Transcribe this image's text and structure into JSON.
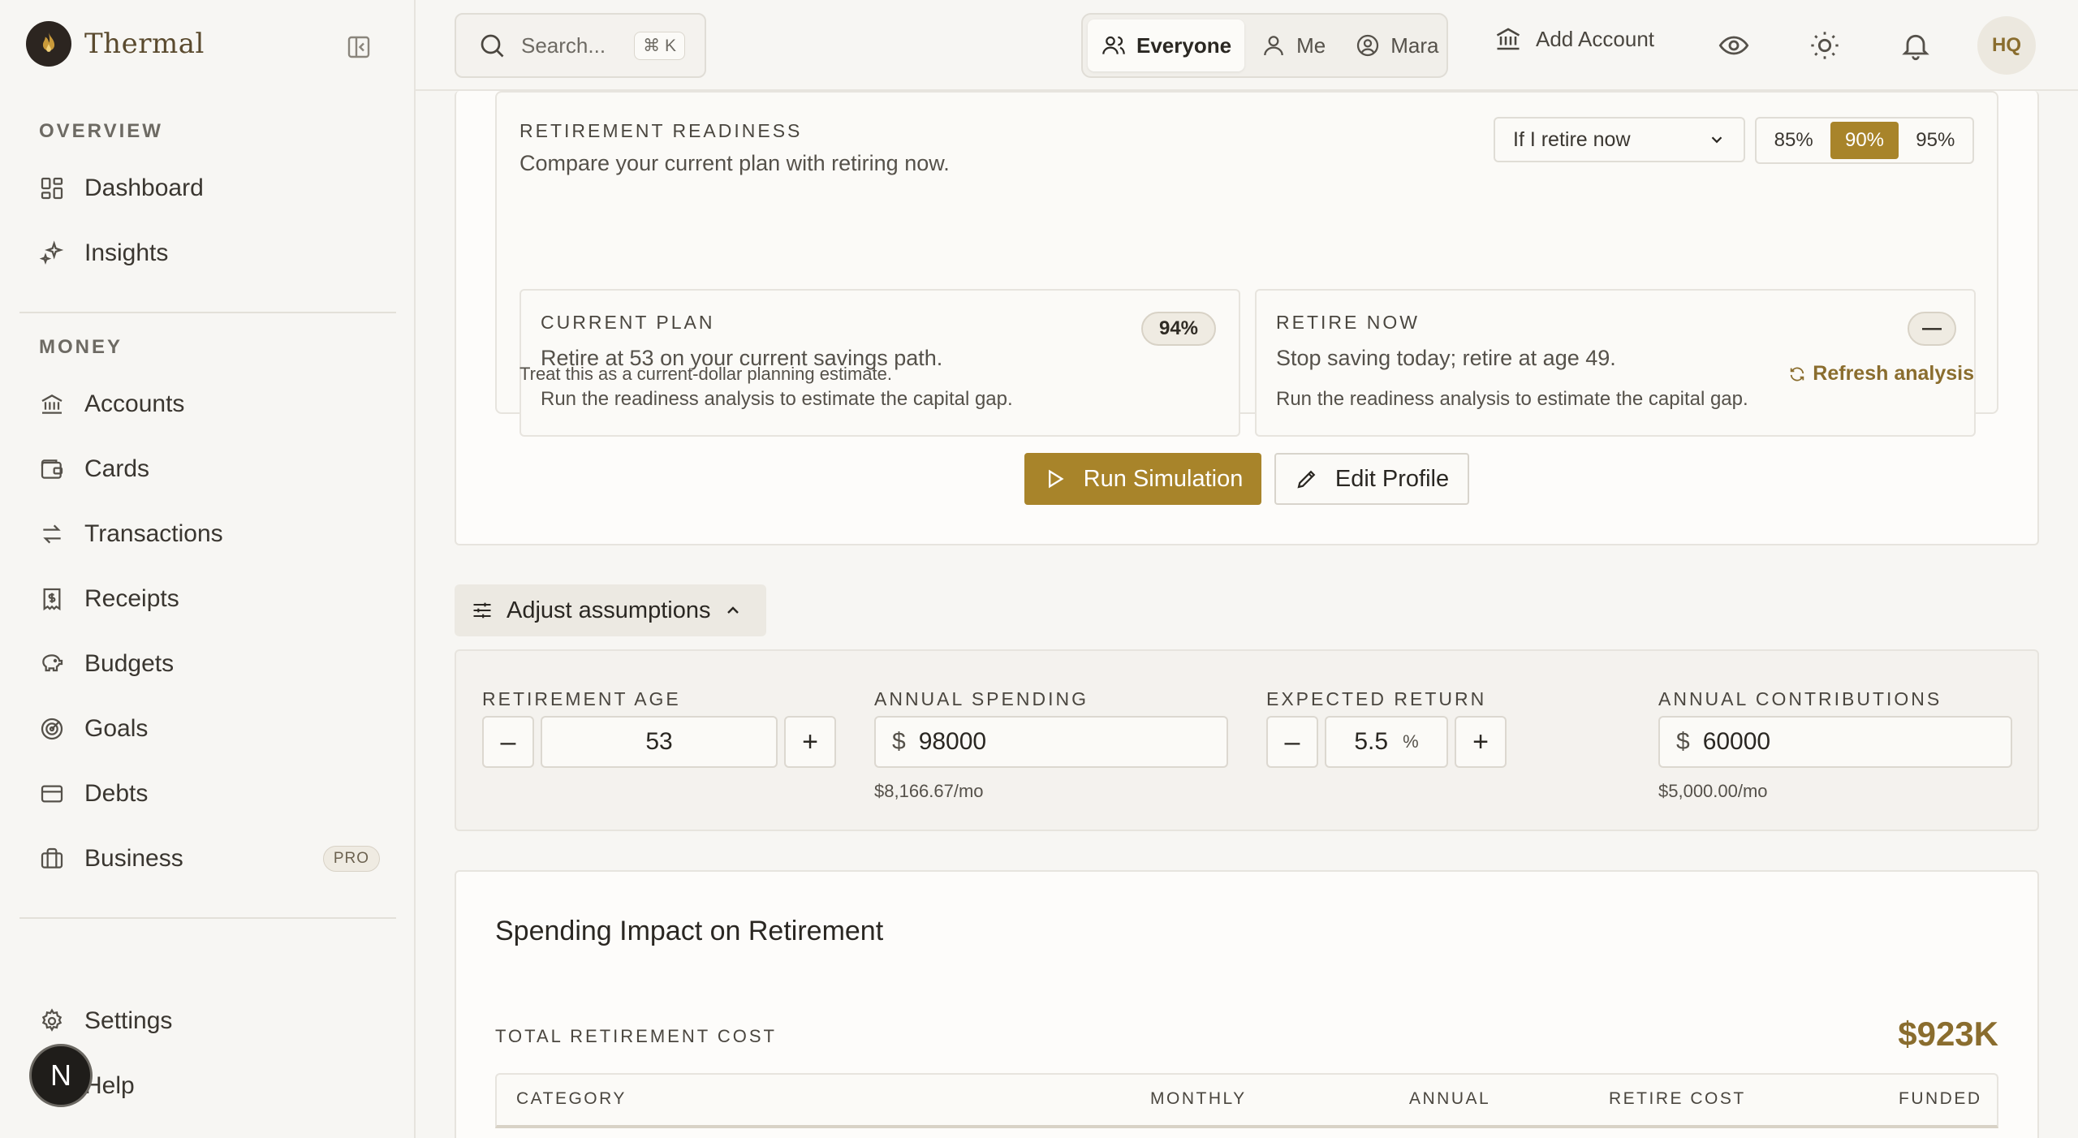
{
  "brand": {
    "name": "Thermal"
  },
  "sidebar": {
    "overview_label": "OVERVIEW",
    "money_label": "MONEY",
    "items": [
      {
        "label": "Dashboard",
        "icon": "dashboard-icon"
      },
      {
        "label": "Insights",
        "icon": "sparkle-icon"
      },
      {
        "label": "Accounts",
        "icon": "bank-icon"
      },
      {
        "label": "Cards",
        "icon": "wallet-icon"
      },
      {
        "label": "Transactions",
        "icon": "arrows-icon"
      },
      {
        "label": "Receipts",
        "icon": "receipt-icon"
      },
      {
        "label": "Budgets",
        "icon": "piggy-bank-icon"
      },
      {
        "label": "Goals",
        "icon": "target-icon"
      },
      {
        "label": "Debts",
        "icon": "credit-card-icon"
      },
      {
        "label": "Business",
        "icon": "briefcase-icon",
        "badge": "PRO"
      },
      {
        "label": "Settings",
        "icon": "gear-icon"
      },
      {
        "label": "Help",
        "icon": "help-icon"
      }
    ],
    "floating_avatar": "N"
  },
  "topbar": {
    "search_placeholder": "Search...",
    "search_shortcut": "⌘ K",
    "scopes": [
      "Everyone",
      "Me",
      "Mara"
    ],
    "active_scope": "Everyone",
    "add_account": "Add Account",
    "user_initials": "HQ"
  },
  "readiness": {
    "title": "RETIREMENT READINESS",
    "subtitle": "Compare your current plan with retiring now.",
    "scenario_select": "If I retire now",
    "confidence_options": [
      "85%",
      "90%",
      "95%"
    ],
    "active_confidence": "90%",
    "current_plan": {
      "title": "CURRENT PLAN",
      "badge": "94%",
      "description": "Retire at 53 on your current savings path.",
      "note": "Run the readiness analysis to estimate the capital gap."
    },
    "retire_now": {
      "title": "RETIRE NOW",
      "badge": "—",
      "description": "Stop saving today; retire at age 49.",
      "note": "Run the readiness analysis to estimate the capital gap."
    },
    "footnote": "Treat this as a current-dollar planning estimate.",
    "refresh": "Refresh analysis"
  },
  "actions": {
    "run": "Run Simulation",
    "edit": "Edit Profile"
  },
  "assumptions": {
    "toggle_label": "Adjust assumptions",
    "retirement_age": {
      "label": "RETIREMENT AGE",
      "value": "53"
    },
    "annual_spending": {
      "label": "ANNUAL SPENDING",
      "prefix": "$",
      "value": "98000",
      "hint": "$8,166.67/mo"
    },
    "expected_return": {
      "label": "EXPECTED RETURN",
      "value": "5.5",
      "suffix": "%"
    },
    "annual_contributions": {
      "label": "ANNUAL CONTRIBUTIONS",
      "prefix": "$",
      "value": "60000",
      "hint": "$5,000.00/mo"
    }
  },
  "spending": {
    "title": "Spending Impact on Retirement",
    "total_label": "TOTAL RETIREMENT COST",
    "total_value": "$923K",
    "columns": [
      "CATEGORY",
      "MONTHLY",
      "ANNUAL",
      "RETIRE COST",
      "FUNDED"
    ]
  },
  "colors": {
    "accent": "#a8842a",
    "background": "#f7f6f3",
    "text": "#2a2722"
  }
}
